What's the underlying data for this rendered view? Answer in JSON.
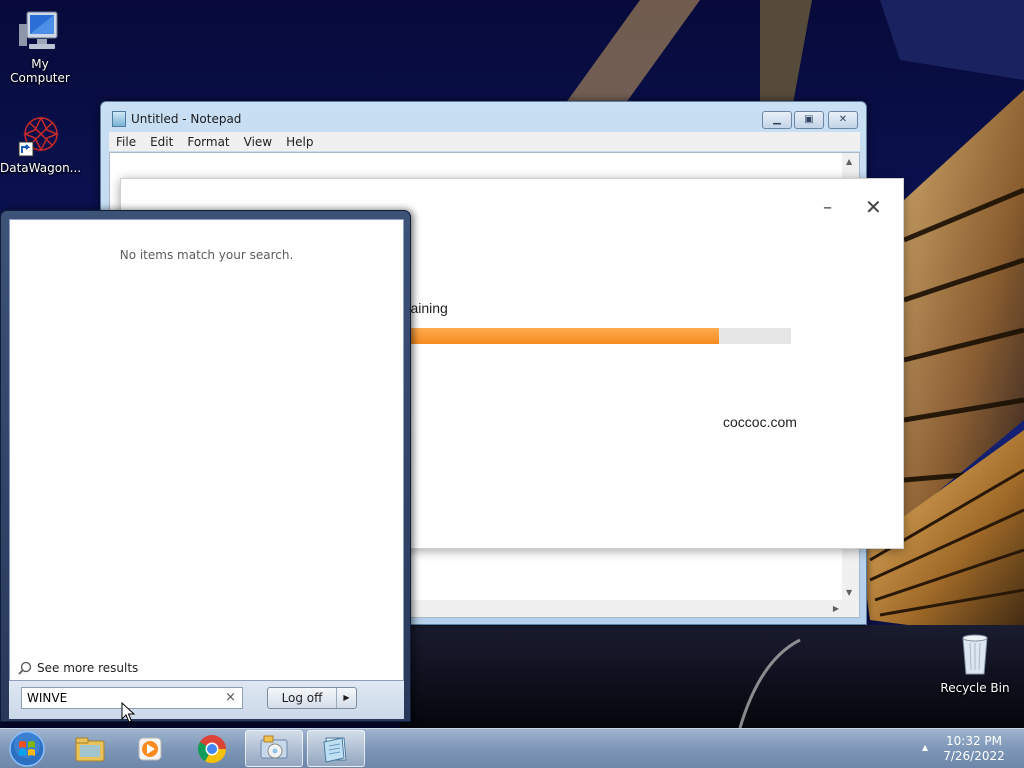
{
  "desktop": {
    "icons": [
      {
        "label": "My Computer"
      },
      {
        "label": "DataWagon..."
      },
      {
        "label": "Recycle Bin"
      }
    ]
  },
  "notepad": {
    "title": "Untitled - Notepad",
    "menu": [
      "File",
      "Edit",
      "Format",
      "View",
      "Help"
    ]
  },
  "dialog": {
    "status_text": "emaining",
    "progress": 0.82,
    "site": "coccoc.com",
    "minimize_glyph": "–",
    "close_glyph": "✕"
  },
  "start_menu": {
    "empty_message": "No items match your search.",
    "see_more": "See more results",
    "search_value": "WINVE",
    "clear_glyph": "×",
    "logoff_label": "Log off"
  },
  "taskbar": {
    "time": "10:32 PM",
    "date": "7/26/2022",
    "pinned": [
      "windows-explorer",
      "media-player",
      "chrome",
      "control-panel",
      "notepad"
    ]
  },
  "colors": {
    "progress_fill": "#f58a1f",
    "progress_track": "#e6e6e6"
  }
}
